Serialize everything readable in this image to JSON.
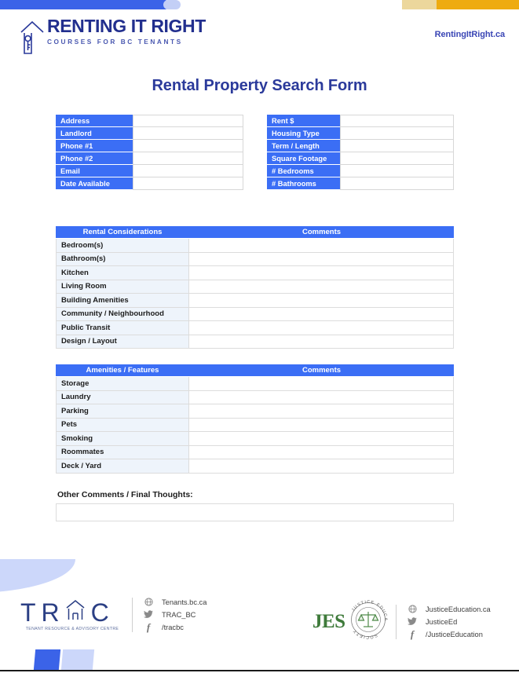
{
  "decor": {
    "top_bar": [
      {
        "name": "blue-segment",
        "color": "#3b63e8"
      },
      {
        "name": "light-blue-segment",
        "color": "#c3cff6"
      },
      {
        "name": "pale-gold-segment",
        "color": "#ecd79c"
      },
      {
        "name": "gold-segment",
        "color": "#eeab10"
      }
    ],
    "accent_blue": "#3b6ef5",
    "title_blue": "#2b3a9b",
    "label_bg": "#eef4fb"
  },
  "header": {
    "brand_name": "RENTING IT RIGHT",
    "brand_tagline": "COURSES FOR BC TENANTS",
    "logo_icon": "house-key-icon",
    "site_url": "RentingItRight.ca"
  },
  "title": "Rental Property Search Form",
  "info": {
    "left_fields": [
      {
        "label": "Address",
        "value": ""
      },
      {
        "label": "Landlord",
        "value": ""
      },
      {
        "label": "Phone #1",
        "value": ""
      },
      {
        "label": "Phone #2",
        "value": ""
      },
      {
        "label": "Email",
        "value": ""
      },
      {
        "label": "Date Available",
        "value": ""
      }
    ],
    "right_fields": [
      {
        "label": "Rent $",
        "value": ""
      },
      {
        "label": "Housing Type",
        "value": ""
      },
      {
        "label": "Term / Length",
        "value": ""
      },
      {
        "label": "Square Footage",
        "value": ""
      },
      {
        "label": "# Bedrooms",
        "value": ""
      },
      {
        "label": "# Bathrooms",
        "value": ""
      }
    ]
  },
  "considerations": {
    "header_label": "Rental Considerations",
    "header_comments": "Comments",
    "rows": [
      {
        "label": "Bedroom(s)",
        "comment": ""
      },
      {
        "label": "Bathroom(s)",
        "comment": ""
      },
      {
        "label": "Kitchen",
        "comment": ""
      },
      {
        "label": "Living Room",
        "comment": ""
      },
      {
        "label": "Building Amenities",
        "comment": ""
      },
      {
        "label": "Community / Neighbourhood",
        "comment": ""
      },
      {
        "label": "Public Transit",
        "comment": ""
      },
      {
        "label": "Design / Layout",
        "comment": ""
      }
    ]
  },
  "amenities": {
    "header_label": "Amenities / Features",
    "header_comments": "Comments",
    "rows": [
      {
        "label": "Storage",
        "comment": ""
      },
      {
        "label": "Laundry",
        "comment": ""
      },
      {
        "label": "Parking",
        "comment": ""
      },
      {
        "label": "Pets",
        "comment": ""
      },
      {
        "label": "Smoking",
        "comment": ""
      },
      {
        "label": "Roommates",
        "comment": ""
      },
      {
        "label": "Deck / Yard",
        "comment": ""
      }
    ]
  },
  "other_comments": {
    "label": "Other Comments / Final Thoughts:",
    "value": ""
  },
  "footer": {
    "trac": {
      "letters": [
        "T",
        "R",
        "⌂",
        "C"
      ],
      "subtitle": "TENANT RESOURCE & ADVISORY CENTRE",
      "links": [
        {
          "icon": "globe-icon",
          "text": "Tenants.bc.ca"
        },
        {
          "icon": "twitter-icon",
          "text": "TRAC_BC"
        },
        {
          "icon": "facebook-icon",
          "text": "/tracbc"
        }
      ]
    },
    "jes": {
      "abbreviation": "JES",
      "seal_text": "JUSTICE EDUCATION SOCIETY",
      "seal_icon": "scales-of-justice-icon",
      "links": [
        {
          "icon": "globe-icon",
          "text": "JusticeEducation.ca"
        },
        {
          "icon": "twitter-icon",
          "text": "JusticeEd"
        },
        {
          "icon": "facebook-icon",
          "text": "/JusticeEducation"
        }
      ]
    }
  }
}
